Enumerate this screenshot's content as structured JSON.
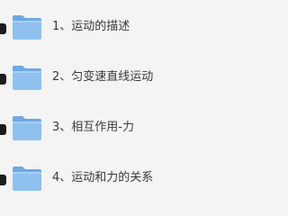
{
  "folders": [
    {
      "label": "1、运动的描述",
      "icon": "folder-icon"
    },
    {
      "label": "2、匀变速直线运动",
      "icon": "folder-icon"
    },
    {
      "label": "3、相互作用-力",
      "icon": "folder-icon"
    },
    {
      "label": "4、运动和力的关系",
      "icon": "folder-icon"
    }
  ],
  "colors": {
    "background": "#f4f4f4",
    "folder_front": "#8fc1ef",
    "folder_back": "#6fa9e2",
    "text": "#3a3a3a",
    "bullet": "#1c1c1c"
  }
}
